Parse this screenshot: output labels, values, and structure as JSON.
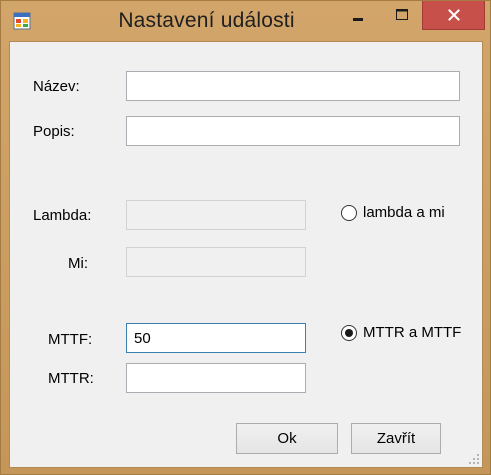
{
  "window": {
    "title": "Nastavení události",
    "icon": "app-form-icon",
    "controls": {
      "minimize_icon": "minimize-icon",
      "maximize_icon": "maximize-icon",
      "close_icon": "close-icon"
    },
    "colors": {
      "frame": "#c89b5d",
      "close_button": "#c7504a",
      "client_background": "#f0f0f0"
    }
  },
  "form": {
    "name": {
      "label": "Název:",
      "value": ""
    },
    "description": {
      "label": "Popis:",
      "value": ""
    },
    "lambda": {
      "label": "Lambda:",
      "value": "",
      "enabled": false
    },
    "mi": {
      "label": "Mi:",
      "value": "",
      "enabled": false
    },
    "mttf": {
      "label": "MTTF:",
      "value": "50",
      "enabled": true
    },
    "mttr": {
      "label": "MTTR:",
      "value": "",
      "enabled": true
    },
    "mode": {
      "options": [
        {
          "label": "lambda a mi",
          "selected": false
        },
        {
          "label": "MTTR a MTTF",
          "selected": true
        }
      ]
    }
  },
  "buttons": {
    "ok_label": "Ok",
    "close_label": "Zavřít"
  }
}
